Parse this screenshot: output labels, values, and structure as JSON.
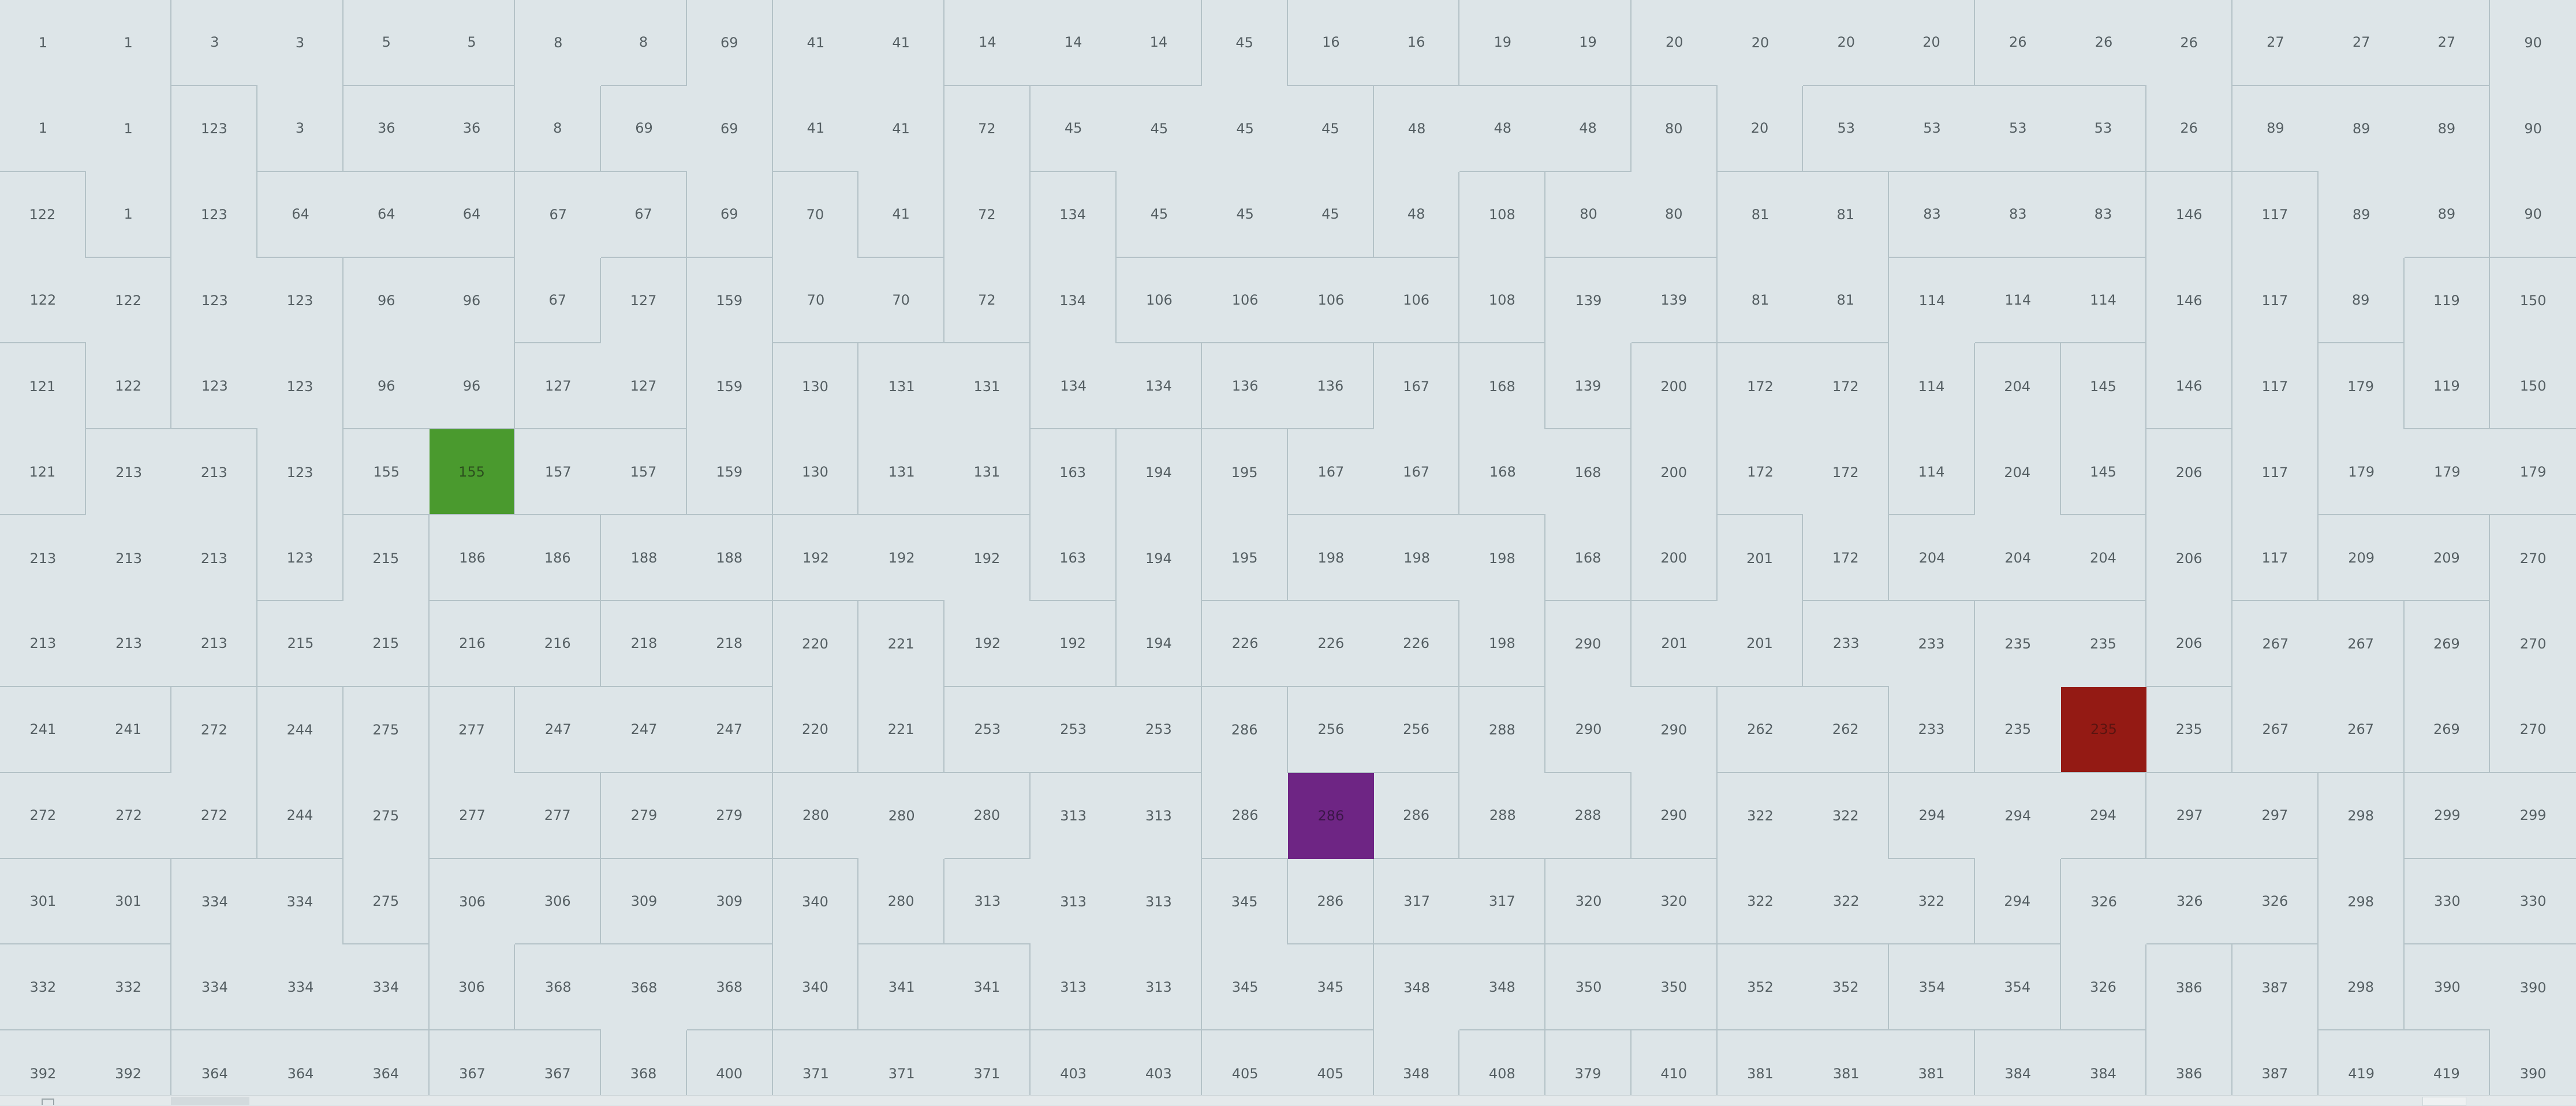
{
  "game": {
    "rows": [
      [
        1,
        1,
        3,
        3,
        5,
        5,
        8,
        8,
        69,
        41,
        41,
        14,
        14,
        14,
        45,
        16,
        16,
        19,
        19,
        20,
        20,
        20,
        20,
        26,
        26,
        26,
        27,
        27,
        27,
        90
      ],
      [
        1,
        1,
        123,
        3,
        36,
        36,
        8,
        69,
        69,
        41,
        41,
        72,
        45,
        45,
        45,
        45,
        48,
        48,
        48,
        80,
        20,
        53,
        53,
        53,
        53,
        26,
        89,
        89,
        89,
        90
      ],
      [
        122,
        1,
        123,
        64,
        64,
        64,
        67,
        67,
        69,
        70,
        41,
        72,
        134,
        45,
        45,
        45,
        48,
        108,
        80,
        80,
        81,
        81,
        83,
        83,
        83,
        146,
        117,
        89,
        89,
        90
      ],
      [
        122,
        122,
        123,
        123,
        96,
        96,
        67,
        127,
        159,
        70,
        70,
        72,
        134,
        106,
        106,
        106,
        106,
        108,
        139,
        139,
        81,
        81,
        114,
        114,
        114,
        146,
        117,
        89,
        119,
        150
      ],
      [
        121,
        122,
        123,
        123,
        96,
        96,
        127,
        127,
        159,
        130,
        131,
        131,
        134,
        134,
        136,
        136,
        167,
        168,
        139,
        200,
        172,
        172,
        114,
        204,
        145,
        146,
        117,
        179,
        119,
        150
      ],
      [
        121,
        213,
        213,
        123,
        155,
        155,
        157,
        157,
        159,
        130,
        131,
        131,
        163,
        194,
        195,
        167,
        167,
        168,
        168,
        200,
        172,
        172,
        114,
        204,
        145,
        206,
        117,
        179,
        179,
        179
      ],
      [
        213,
        213,
        213,
        123,
        215,
        186,
        186,
        188,
        188,
        192,
        192,
        192,
        163,
        194,
        195,
        198,
        198,
        198,
        168,
        200,
        201,
        172,
        204,
        204,
        204,
        206,
        117,
        209,
        209,
        270
      ],
      [
        213,
        213,
        213,
        215,
        215,
        216,
        216,
        218,
        218,
        220,
        221,
        192,
        192,
        194,
        226,
        226,
        226,
        198,
        290,
        201,
        201,
        233,
        233,
        235,
        235,
        206,
        267,
        267,
        269,
        270
      ],
      [
        241,
        241,
        272,
        244,
        275,
        277,
        247,
        247,
        247,
        220,
        221,
        253,
        253,
        253,
        286,
        256,
        256,
        288,
        290,
        290,
        262,
        262,
        233,
        235,
        235,
        235,
        267,
        267,
        269,
        270
      ],
      [
        272,
        272,
        272,
        244,
        275,
        277,
        277,
        279,
        279,
        280,
        280,
        280,
        313,
        313,
        286,
        286,
        286,
        288,
        288,
        290,
        322,
        322,
        294,
        294,
        294,
        297,
        297,
        298,
        299,
        299
      ],
      [
        301,
        301,
        334,
        334,
        275,
        306,
        306,
        309,
        309,
        340,
        280,
        313,
        313,
        313,
        345,
        286,
        317,
        317,
        320,
        320,
        322,
        322,
        322,
        294,
        326,
        326,
        326,
        298,
        330,
        330
      ],
      [
        332,
        332,
        334,
        334,
        334,
        306,
        368,
        368,
        368,
        340,
        341,
        341,
        313,
        313,
        345,
        345,
        348,
        348,
        350,
        350,
        352,
        352,
        354,
        354,
        326,
        386,
        387,
        298,
        390,
        390
      ],
      [
        392,
        392,
        364,
        364,
        364,
        367,
        367,
        368,
        400,
        371,
        371,
        371,
        403,
        403,
        405,
        405,
        348,
        408,
        379,
        410,
        381,
        381,
        381,
        384,
        384,
        386,
        387,
        419,
        419,
        390
      ]
    ],
    "highlights": {
      "start": {
        "row": 5,
        "col": 5,
        "color": "#4a9a2e"
      },
      "target": {
        "row": 8,
        "col": 24,
        "color": "#941a14"
      },
      "current": {
        "row": 9,
        "col": 15,
        "color": "#6e2584"
      }
    },
    "colors": {
      "background": "#dde5e8",
      "wall": "#b4c2c7",
      "text": "#555f63"
    }
  }
}
